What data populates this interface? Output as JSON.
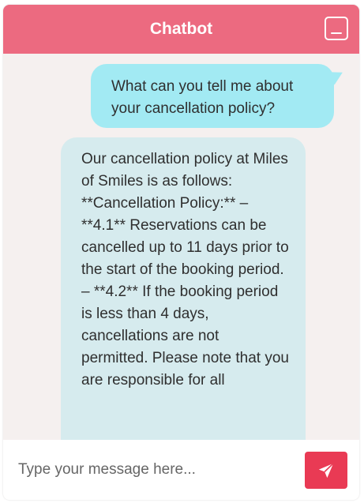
{
  "header": {
    "title": "Chatbot",
    "minimize_icon": "minimize-icon"
  },
  "messages": [
    {
      "sender": "user",
      "text": "What can you tell me about your cancellation policy?"
    },
    {
      "sender": "bot",
      "text": "Our cancellation policy at Miles of Smiles is as follows: **Cancellation Policy:** – **4.1** Reservations can be cancelled up to 11 days prior to the start of the booking period. – **4.2** If the booking period is less than 4 days, cancellations are not permitted. Please note that you are responsible for all"
    }
  ],
  "composer": {
    "placeholder": "Type your message here...",
    "value": "",
    "send_icon": "send-icon"
  },
  "colors": {
    "header": "#ec6a80",
    "user_bubble": "#a2eaf3",
    "bot_bubble": "#d6ebee",
    "send_button": "#e93a54",
    "background": "#f5f0ef"
  }
}
